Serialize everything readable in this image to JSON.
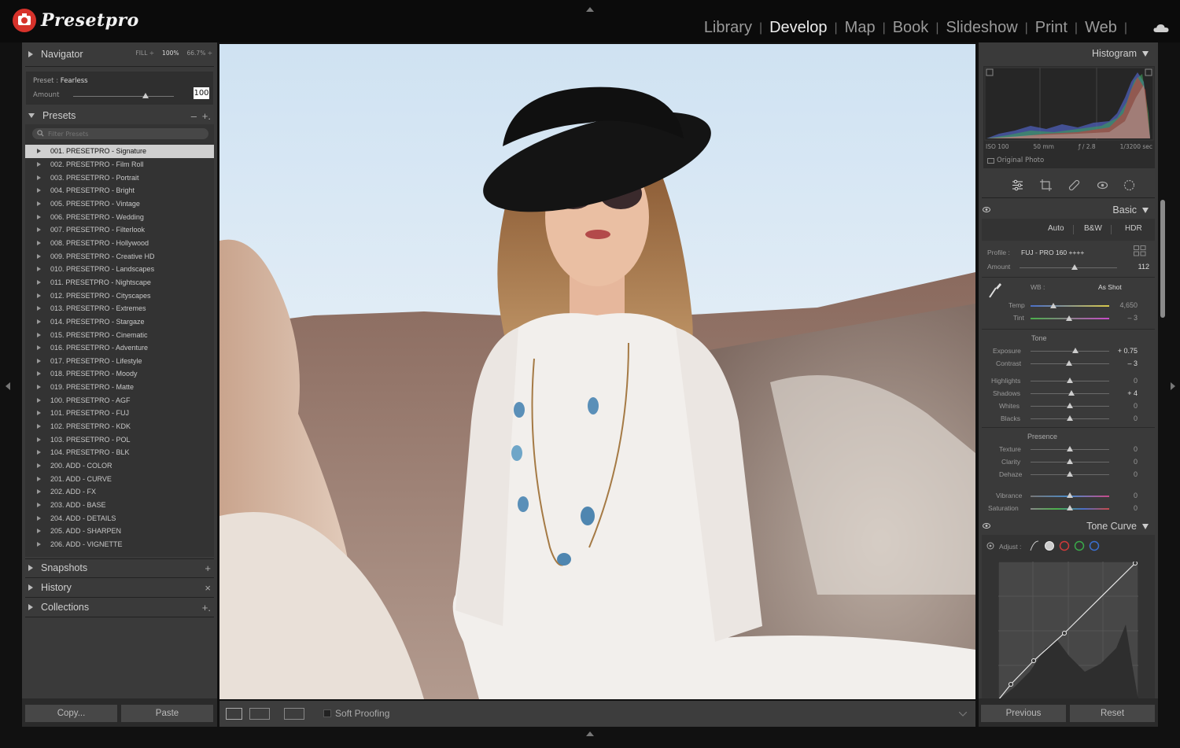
{
  "app": {
    "logo_text": "Presetpro",
    "modules": [
      "Library",
      "Develop",
      "Map",
      "Book",
      "Slideshow",
      "Print",
      "Web"
    ],
    "active_module": "Develop"
  },
  "left": {
    "navigator": {
      "label": "Navigator",
      "zoom": [
        "FILL ÷",
        "100%",
        "66.7% ÷"
      ]
    },
    "preset_info": {
      "label": "Preset :",
      "name": "Fearless",
      "amount_label": "Amount",
      "amount_value": "100",
      "amount_fraction": 0.72
    },
    "presets": {
      "label": "Presets",
      "filter_placeholder": "Filter Presets",
      "items": [
        "001. PRESETPRO - Signature",
        "002. PRESETPRO - Film Roll",
        "003. PRESETPRO - Portrait",
        "004. PRESETPRO - Bright",
        "005. PRESETPRO - Vintage",
        "006. PRESETPRO - Wedding",
        "007. PRESETPRO - Filterlook",
        "008. PRESETPRO - Hollywood",
        "009. PRESETPRO - Creative HD",
        "010. PRESETPRO - Landscapes",
        "011. PRESETPRO - Nightscape",
        "012. PRESETPRO - Cityscapes",
        "013. PRESETPRO - Extremes",
        "014. PRESETPRO - Stargaze",
        "015. PRESETPRO - Cinematic",
        "016. PRESETPRO - Adventure",
        "017. PRESETPRO - Lifestyle",
        "018. PRESETPRO - Moody",
        "019. PRESETPRO - Matte",
        "100. PRESETPRO - AGF",
        "101. PRESETPRO - FUJ",
        "102. PRESETPRO - KDK",
        "103. PRESETPRO - POL",
        "104. PRESETPRO - BLK",
        "200. ADD - COLOR",
        "201. ADD - CURVE",
        "202. ADD - FX",
        "203. ADD - BASE",
        "204. ADD - DETAILS",
        "205. ADD - SHARPEN",
        "206. ADD - VIGNETTE"
      ],
      "selected_index": 0
    },
    "snapshots_label": "Snapshots",
    "history_label": "History",
    "collections_label": "Collections",
    "copy_label": "Copy...",
    "paste_label": "Paste"
  },
  "toolbar": {
    "soft_proofing": "Soft Proofing"
  },
  "right": {
    "histogram_label": "Histogram",
    "exif": [
      "ISO 100",
      "50 mm",
      "ƒ / 2.8",
      "1/3200 sec"
    ],
    "original_photo": "Original Photo",
    "basic_label": "Basic",
    "treatments": [
      "Auto",
      "B&W",
      "HDR"
    ],
    "profile_label": "Profile :",
    "profile_value": "FUJ - PRO 160 ++++",
    "profile_amount_label": "Amount",
    "profile_amount": "112",
    "wb_label": "WB :",
    "wb_value": "As Shot",
    "temp": {
      "label": "Temp",
      "value": "4,650"
    },
    "tint": {
      "label": "Tint",
      "value": "– 3"
    },
    "tone_label": "Tone",
    "exposure": {
      "label": "Exposure",
      "value": "+ 0.75"
    },
    "contrast": {
      "label": "Contrast",
      "value": "– 3"
    },
    "highlights": {
      "label": "Highlights",
      "value": "0"
    },
    "shadows": {
      "label": "Shadows",
      "value": "+ 4"
    },
    "whites": {
      "label": "Whites",
      "value": "0"
    },
    "blacks": {
      "label": "Blacks",
      "value": "0"
    },
    "presence_label": "Presence",
    "texture": {
      "label": "Texture",
      "value": "0"
    },
    "clarity": {
      "label": "Clarity",
      "value": "0"
    },
    "dehaze": {
      "label": "Dehaze",
      "value": "0"
    },
    "vibrance": {
      "label": "Vibrance",
      "value": "0"
    },
    "saturation": {
      "label": "Saturation",
      "value": "0"
    },
    "tone_curve_label": "Tone Curve",
    "adjust_label": "Adjust :",
    "previous_label": "Previous",
    "reset_label": "Reset"
  },
  "colors": {
    "accent_red": "#d6322b",
    "panel": "#3a3a3a",
    "background": "#111111"
  }
}
